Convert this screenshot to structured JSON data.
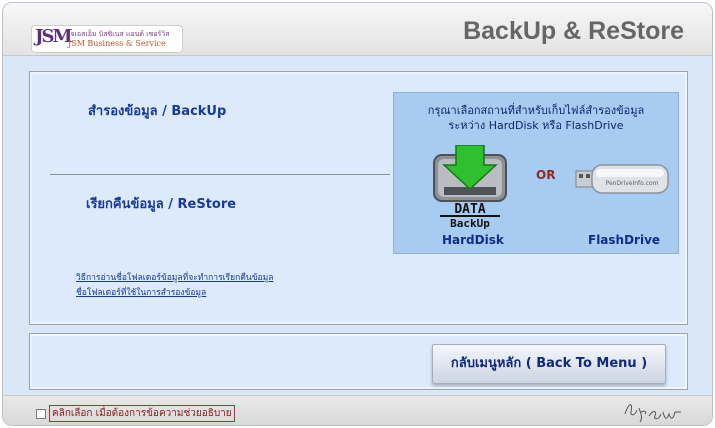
{
  "header": {
    "logo": {
      "mark": "JSM",
      "line1": "เจเอสเอ็ม บิสซิเนส แอนด์ เซอร์วิส",
      "line2": "JSM Business & Service"
    },
    "title": "BackUp  &  ReStore"
  },
  "main": {
    "backup_label": "สำรองข้อมูล / BackUp",
    "restore_label": "เรียกคืนข้อมูล / ReStore",
    "links": [
      "วิธีการอ่านชื่อโฟลเดอร์ข้อมูลที่จะทำการเรียกคืนข้อมูล",
      "ชื่อโฟลเดอร์ที่ใช้ในการสำรองข้อมูล"
    ]
  },
  "destination": {
    "prompt_line1": "กรุณาเลือกสถานที่สำหรับเก็บไฟล์สำรองข้อมูล",
    "prompt_line2": "ระหว่าง HardDisk หรือ FlashDrive",
    "or_label": "OR",
    "harddisk_label": "HardDisk",
    "flashdrive_label": "FlashDrive",
    "hdd_icon_text1": "DATA",
    "hdd_icon_text2": "BackUp",
    "flash_icon_text": "PenDriveInfo.com"
  },
  "bottom": {
    "menu_button": "กลับเมนูหลัก ( Back To Menu )"
  },
  "footer": {
    "help_label": "คลิกเลือก เมื่อต้องการข้อความช่วยอธิบาย",
    "signature": "By Shaw"
  },
  "colors": {
    "link": "#163a9a",
    "panel": "#dceafc",
    "dest_box": "#a7cbf1",
    "arrow_green": "#2fbf2f"
  }
}
